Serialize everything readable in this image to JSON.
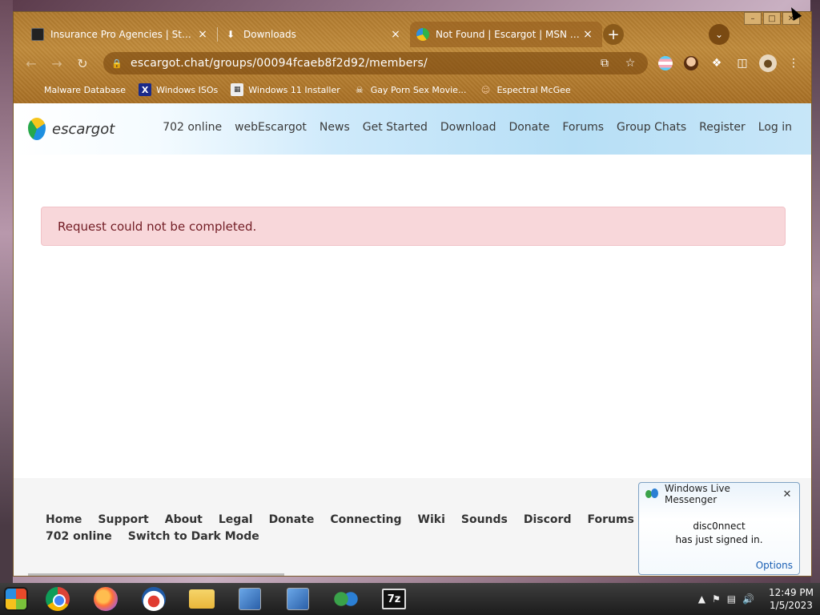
{
  "browser": {
    "tabs": [
      {
        "title": "Insurance Pro Agencies | Start a"
      },
      {
        "title": "Downloads"
      },
      {
        "title": "Not Found | Escargot | MSN Me..."
      }
    ],
    "new_tab_label": "+",
    "address": "escargot.chat/groups/00094fcaeb8f2d92/members/",
    "bookmarks": [
      {
        "label": "Malware Database"
      },
      {
        "label": "Windows ISOs"
      },
      {
        "label": "Windows 11 Installer"
      },
      {
        "label": "Gay Porn Sex Movie..."
      },
      {
        "label": "Espectral McGee"
      }
    ]
  },
  "site": {
    "logo_text": "escargot",
    "nav": [
      {
        "label": "702 online"
      },
      {
        "label": "webEscargot"
      },
      {
        "label": "News"
      },
      {
        "label": "Get Started"
      },
      {
        "label": "Download"
      },
      {
        "label": "Donate"
      },
      {
        "label": "Forums"
      },
      {
        "label": "Group Chats"
      },
      {
        "label": "Register"
      },
      {
        "label": "Log in"
      }
    ],
    "alert": "Request could not be completed.",
    "footer_links": [
      {
        "label": "Home"
      },
      {
        "label": "Support"
      },
      {
        "label": "About"
      },
      {
        "label": "Legal"
      },
      {
        "label": "Donate"
      },
      {
        "label": "Connecting"
      },
      {
        "label": "Wiki"
      },
      {
        "label": "Sounds"
      },
      {
        "label": "Discord"
      },
      {
        "label": "Forums"
      },
      {
        "label": "702 online"
      },
      {
        "label": "Switch to Dark Mode"
      }
    ]
  },
  "notification": {
    "title": "Windows Live Messenger",
    "user": "disc0nnect",
    "message": "has just signed in.",
    "options_label": "Options"
  },
  "taskbar": {
    "apps": [
      "start-orb",
      "chrome",
      "firefox",
      "obama",
      "file-explorer",
      "installer",
      "installer",
      "msn",
      "7zip"
    ],
    "sevenzip_label": "7z",
    "time": "12:49 PM",
    "date": "1/5/2023"
  }
}
